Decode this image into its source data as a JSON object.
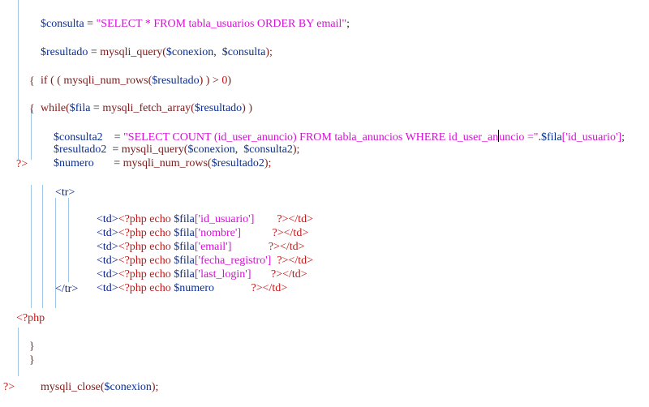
{
  "code": {
    "line1": {
      "var": "$consulta",
      "op": " = ",
      "str": "\"SELECT * FROM tabla_usuarios ORDER BY email\"",
      "end": ";"
    },
    "line2": {
      "var": "$resultado",
      "op": " = ",
      "fn": "mysqli_query(",
      "arg1": "$conexion",
      "sep": ",  ",
      "arg2": "$consulta",
      "end": ");"
    },
    "line3": {
      "kw": "if",
      "p1": " ( ( ",
      "fn": "mysqli_num_rows(",
      "arg": "$resultado",
      "p2": ") ) > ",
      "num": "0",
      "p3": ")"
    },
    "line4": {
      "brace": "{"
    },
    "line5": {
      "kw": "while(",
      "var": "$fila",
      "op": " = ",
      "fn": "mysqli_fetch_array(",
      "arg": "$resultado",
      "end": ") )"
    },
    "line6": {
      "brace": "{"
    },
    "line7": {
      "var": "$consulta2",
      "op": "    = ",
      "str_a": "\"SELECT COUNT (id_user_anuncio) FROM tabla_anuncios WHERE id_user_an",
      "str_b": "uncio =\"",
      "cat": ".",
      "var2": "$fila",
      "idx": "['id_usuario']",
      "end": ";"
    },
    "line8": {
      "var": "$resultado2",
      "op": "  = ",
      "fn": "mysqli_query(",
      "arg1": "$conexion",
      "sep": ",  ",
      "arg2": "$consulta2",
      "end": ");"
    },
    "line9": {
      "var": "$numero",
      "op": "       = ",
      "fn": "mysqli_num_rows(",
      "arg": "$resultado2",
      "end": ");"
    },
    "line10": {
      "tag": "?>"
    },
    "tr_open": "<tr>",
    "td_rows": [
      {
        "open": "<td>",
        "php": "<?php echo ",
        "var": "$fila",
        "idx": "['id_usuario']",
        "pad": "        ",
        "close": "?></td>"
      },
      {
        "open": "<td>",
        "php": "<?php echo ",
        "var": "$fila",
        "idx": "['nombre']",
        "pad": "           ",
        "close": "?></td>"
      },
      {
        "open": "<td>",
        "php": "<?php echo ",
        "var": "$fila",
        "idx": "['email']",
        "pad": "             ",
        "close": "?></td>"
      },
      {
        "open": "<td>",
        "php": "<?php echo ",
        "var": "$fila",
        "idx": "['fecha_registro']",
        "pad": "  ",
        "close": "?></td>"
      },
      {
        "open": "<td>",
        "php": "<?php echo ",
        "var": "$fila",
        "idx": "['last_login']",
        "pad": "       ",
        "close": "?></td>"
      },
      {
        "open": "<td>",
        "php": "<?php echo ",
        "var": "$numero",
        "idx": "",
        "pad": "             ",
        "close": "?></td>"
      }
    ],
    "tr_close": "</tr>",
    "php_open": "<?php",
    "close_brace_1": "}",
    "close_brace_2": "}",
    "close_line": {
      "fn": "mysqli_close(",
      "arg": "$conexion",
      "end": ");"
    },
    "php_close": "?>"
  },
  "colors": {
    "variable": "#0b2f8f",
    "function": "#7a1a1a",
    "string": "#d60fd6",
    "html_tag": "#0a1e8c",
    "php_tag": "#c01818",
    "indent_guide": "#9ec4e6"
  }
}
